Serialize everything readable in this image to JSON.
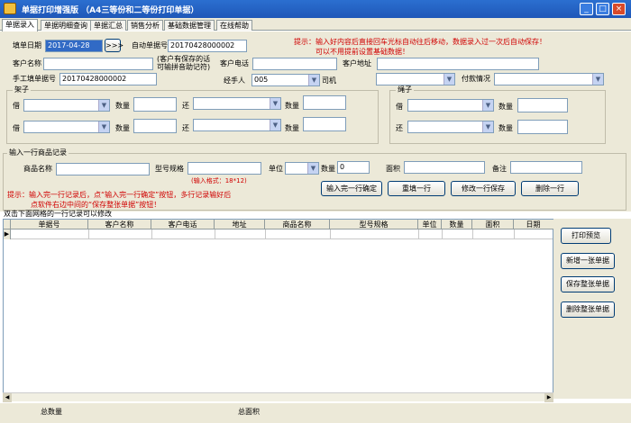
{
  "window": {
    "title": "单据打印增强版 （A4三等份和二等份打印单据）",
    "controls": [
      "_",
      "□",
      "×"
    ]
  },
  "tabs": [
    "单据录入",
    "单据明细查询",
    "单据汇总",
    "销售分析",
    "基础数据管理",
    "在线帮助"
  ],
  "form": {
    "date_label": "填单日期",
    "date_value": "2017-04-28",
    "date_button": ">>>",
    "auto_no_label": "自动单据号",
    "auto_no_value": "20170428000002",
    "tip_line1": "提示：输入好内容后直接回车光标自动往后移动，数据录入过一次后自动保存！",
    "tip_line2": "可以不用提前设置基础数据！",
    "customer_label": "客户名称",
    "customer_note": "(客户有保存的话可输拼音助记符)",
    "phone_label": "客户电话",
    "address_label": "客户地址",
    "manual_no_label": "手工填单据号",
    "manual_no_value": "20170428000002",
    "handler_label": "经手人",
    "handler_value": "005",
    "driver_label": "司机",
    "payment_label": "付款情况"
  },
  "group_frame": {
    "title": "架子",
    "borrow_label": "借",
    "qty_label": "数量",
    "return_label": "还"
  },
  "group_rope": {
    "title": "绳子",
    "borrow_label": "借",
    "qty_label": "数量",
    "return_label": "还"
  },
  "line_entry": {
    "title": "输入一行商品记录",
    "product_label": "商品名称",
    "spec_label": "型号规格",
    "unit_label": "单位",
    "qty_label": "数量",
    "qty_value": "0",
    "area_label": "面积",
    "remark_label": "备注",
    "format_hint": "(输入格式：18*12)",
    "tip_line1": "提示：输入完一行记录后，点“输入完一行确定”按钮，多行记录输好后",
    "tip_line2": "点软件右边中间的“保存整张单据”按钮！",
    "buttons": [
      "输入完一行确定",
      "重填一行",
      "修改一行保存",
      "删除一行"
    ]
  },
  "grid": {
    "caption": "双击下面网格的一行记录可以修改",
    "columns": [
      "单据号",
      "客户名称",
      "客户电话",
      "地址",
      "商品名称",
      "型号规格",
      "单位",
      "数量",
      "面积",
      "日期"
    ]
  },
  "side_buttons": [
    "打印预览",
    "新增一张单据",
    "保存整张单据",
    "删除整张单据"
  ],
  "footer": {
    "total_qty_label": "总数量",
    "total_area_label": "总面积"
  }
}
